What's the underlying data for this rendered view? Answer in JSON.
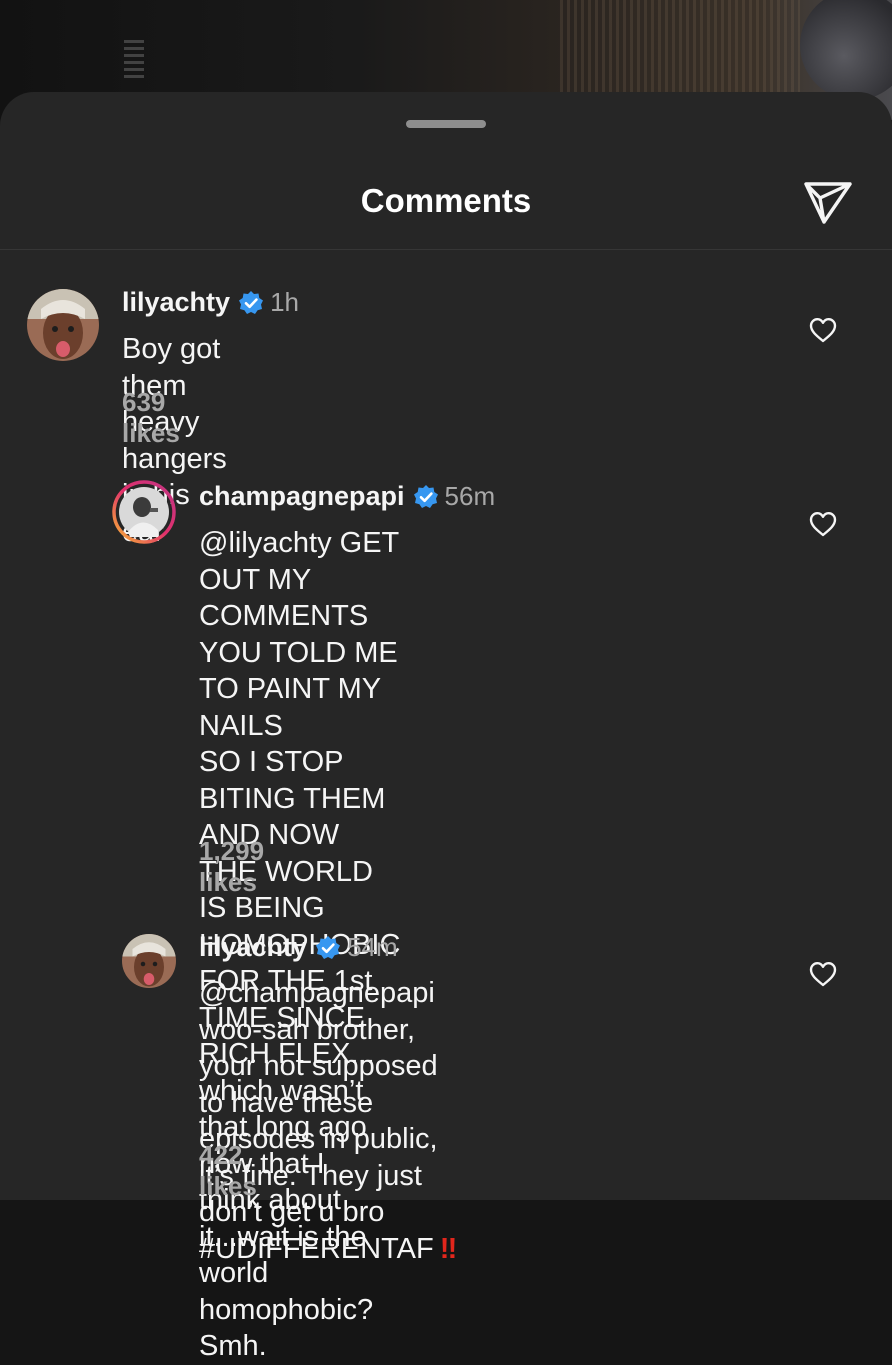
{
  "sheet": {
    "title": "Comments",
    "share_icon": "paper-plane-icon"
  },
  "comments": [
    {
      "username": "lilyachty",
      "verified": true,
      "time": "1h",
      "text": "Boy got them heavy hangers in his ear",
      "likes": "639 likes",
      "is_reply": false
    },
    {
      "username": "champagnepapi",
      "verified": true,
      "time": "56m",
      "text": "@lilyachty GET OUT MY COMMENTS\nYOU TOLD ME TO PAINT MY NAILS\nSO I STOP BITING THEM AND NOW\nTHE WORLD IS BEING HOMOPHOBIC\nFOR THE 1st TIME SINCE RICH FLEX...\nwhich wasn’t that long ago now that I\nthink about it...wait is the world\nhomophobic? Smh.",
      "likes": "1,299 likes",
      "is_reply": true
    },
    {
      "username": "lilyachty",
      "verified": true,
      "time": "54m",
      "text": "@champagnepapi woo-sah brother,\nyour not supposed to have these\nepisodes in public, it’s fine. They just\ndon’t get u bro #UDIFFERENTAF",
      "text_suffix": "‼",
      "likes": "422 likes",
      "is_reply": true
    }
  ],
  "colors": {
    "sheet_bg": "#262626",
    "text_primary": "#f5f5f5",
    "text_secondary": "#a8a8a8",
    "verified_blue": "#3797f0",
    "emoji_red": "#e2261c"
  }
}
